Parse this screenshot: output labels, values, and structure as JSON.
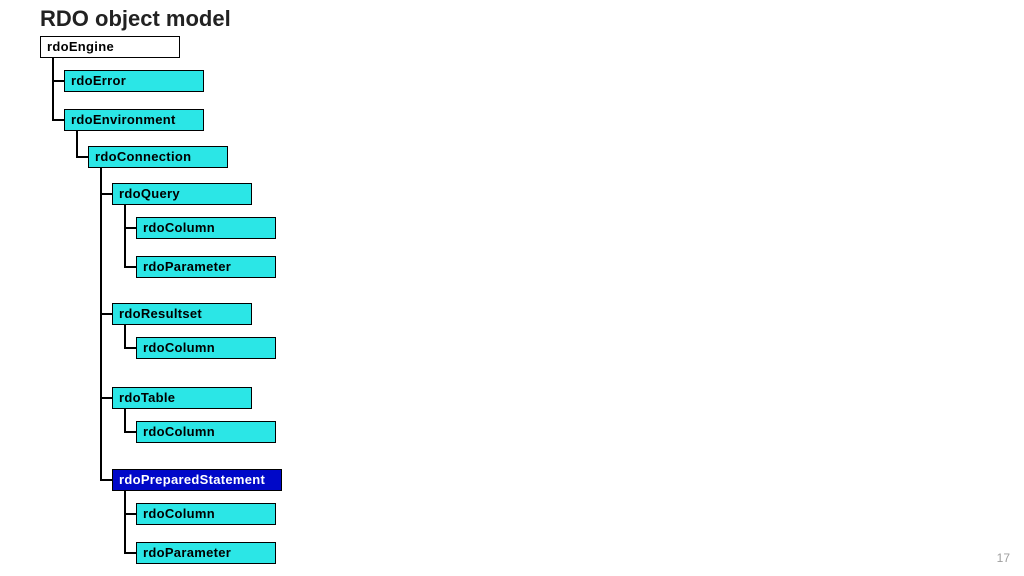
{
  "title": "RDO object model",
  "page_number": "17",
  "colors": {
    "cyan": "#2be6e6",
    "selected_bg": "#0008c8",
    "selected_fg": "#ffffff",
    "border": "#000000"
  },
  "nodes": {
    "engine": {
      "label": "rdoEngine"
    },
    "error": {
      "label": "rdoError"
    },
    "environment": {
      "label": "rdoEnvironment"
    },
    "connection": {
      "label": "rdoConnection"
    },
    "query": {
      "label": "rdoQuery"
    },
    "q_column": {
      "label": "rdoColumn"
    },
    "q_parameter": {
      "label": "rdoParameter"
    },
    "resultset": {
      "label": "rdoResultset"
    },
    "rs_column": {
      "label": "rdoColumn"
    },
    "table": {
      "label": "rdoTable"
    },
    "t_column": {
      "label": "rdoColumn"
    },
    "prepared": {
      "label": "rdoPreparedStatement"
    },
    "p_column": {
      "label": "rdoColumn"
    },
    "p_parameter": {
      "label": "rdoParameter"
    }
  },
  "hierarchy": {
    "rdoEngine": {
      "rdoError": {},
      "rdoEnvironment": {
        "rdoConnection": {
          "rdoQuery": {
            "rdoColumn": {},
            "rdoParameter": {}
          },
          "rdoResultset": {
            "rdoColumn": {}
          },
          "rdoTable": {
            "rdoColumn": {}
          },
          "rdoPreparedStatement": {
            "rdoColumn": {},
            "rdoParameter": {}
          }
        }
      }
    }
  }
}
